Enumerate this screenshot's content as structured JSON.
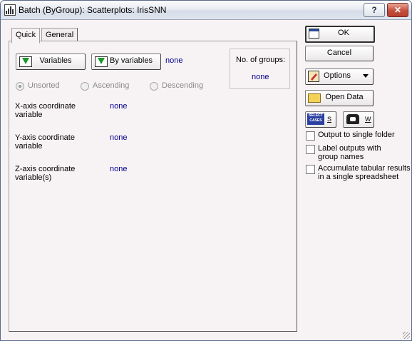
{
  "window": {
    "title": "Batch (ByGroup): Scatterplots: IrisSNN",
    "help": "?",
    "close": "✕"
  },
  "tabs": {
    "quick": "Quick",
    "general": "General"
  },
  "buttons": {
    "ok": "OK",
    "cancel": "Cancel",
    "options": "Options",
    "open_data": "Open Data",
    "variables": "Variables",
    "by_variables": "By variables",
    "select_cases_top": "SELECT",
    "select_cases_bottom": "CASES",
    "select_cases_key": "S",
    "weight_key": "W"
  },
  "by_variables_value": "none",
  "groups": {
    "label": "No. of groups:",
    "value": "none"
  },
  "sort": {
    "options": [
      "Unsorted",
      "Ascending",
      "Descending"
    ],
    "selected": "Unsorted"
  },
  "fields": [
    {
      "label_line1": "X-axis coordinate",
      "label_line2": "variable",
      "value": "none"
    },
    {
      "label_line1": "Y-axis coordinate",
      "label_line2": "variable",
      "value": "none"
    },
    {
      "label_line1": "Z-axis coordinate",
      "label_line2": "variable(s)",
      "value": "none"
    }
  ],
  "checkboxes": [
    {
      "line1": "Output to single folder",
      "line2": "",
      "checked": false
    },
    {
      "line1": "Label outputs with",
      "line2": "group names",
      "checked": false
    },
    {
      "line1": "Accumulate tabular results",
      "line2": "in a single spreadsheet",
      "checked": false
    }
  ]
}
